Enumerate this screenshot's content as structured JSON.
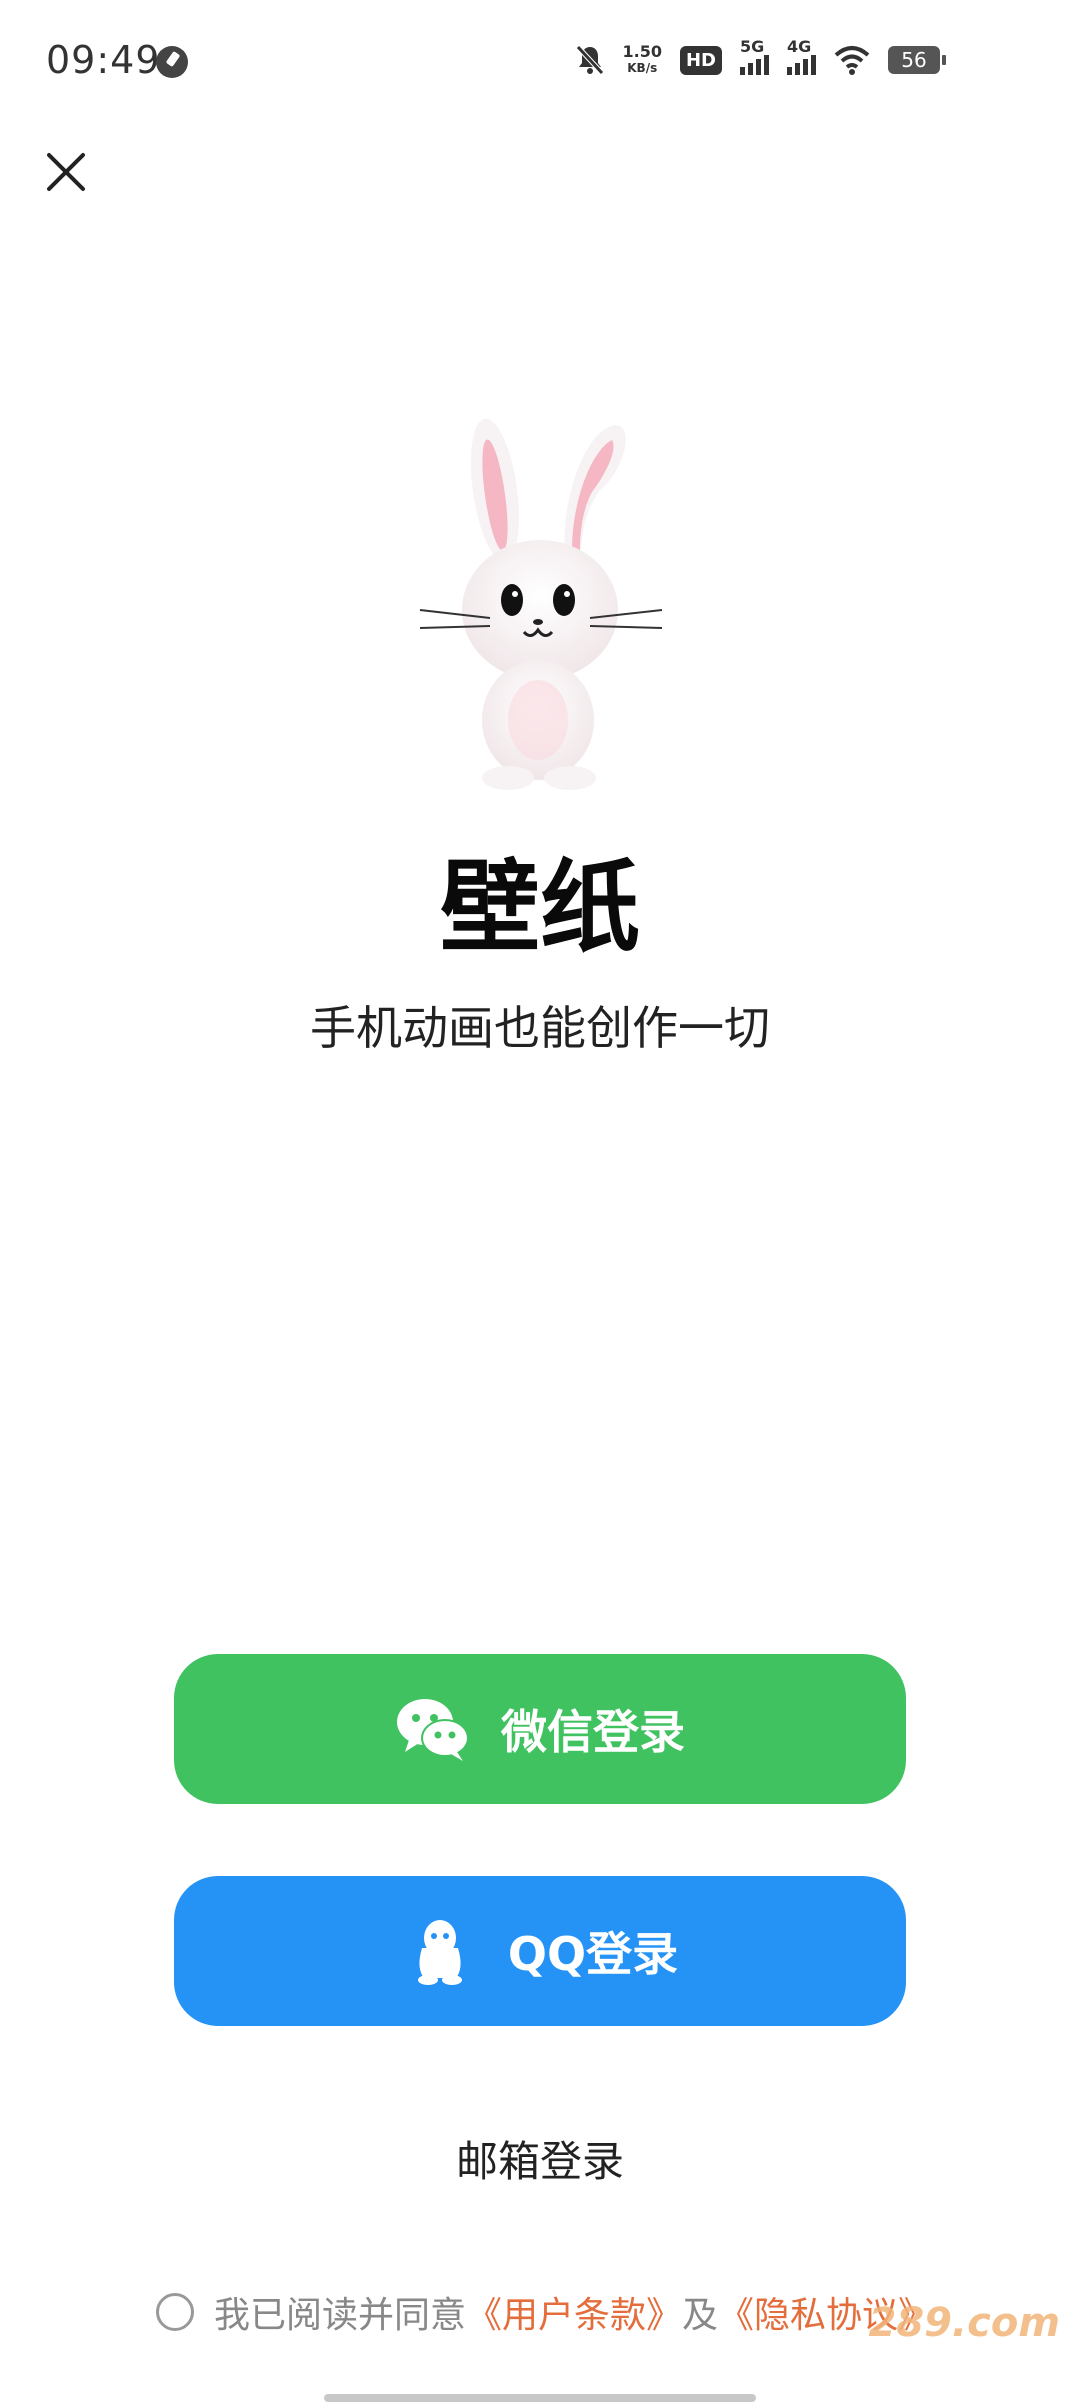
{
  "status_bar": {
    "time": "09:49",
    "net_speed_value": "1.50",
    "net_speed_unit": "KB/s",
    "hd_badge": "HD",
    "sim_labels": [
      "5G",
      "4G"
    ],
    "battery_level": "56",
    "icons": [
      "speed-dial-icon",
      "mute-icon",
      "hd-icon",
      "signal-5g-icon",
      "signal-4g-icon",
      "wifi-icon",
      "battery-icon"
    ]
  },
  "app": {
    "title": "壁纸",
    "subtitle": "手机动画也能创作一切"
  },
  "buttons": {
    "wechat_login": "微信登录",
    "qq_login": "QQ登录",
    "email_login": "邮箱登录"
  },
  "colors": {
    "wechat": "#41c261",
    "qq": "#2592f6",
    "link": "#e46d3c"
  },
  "agreement": {
    "prefix": "我已阅读并同意",
    "terms_link": "《用户条款》",
    "conjunction": "及",
    "privacy_link": "《隐私协议》"
  },
  "watermark": "289.com"
}
